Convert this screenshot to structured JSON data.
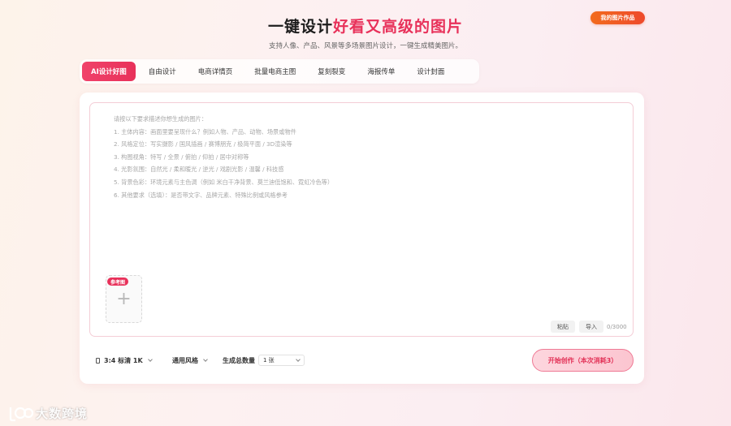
{
  "header": {
    "title_plain": "一键设计",
    "title_highlight": "好看又高级的图片",
    "subtitle": "支持人像、产品、风景等多场景图片设计，一键生成精美图片。",
    "my_works_label": "我的图片作品"
  },
  "tabs": [
    {
      "label": "AI设计好图",
      "active": true
    },
    {
      "label": "自由设计",
      "active": false
    },
    {
      "label": "电商详情页",
      "active": false
    },
    {
      "label": "批量电商主图",
      "active": false
    },
    {
      "label": "复刻裂变",
      "active": false
    },
    {
      "label": "海报传单",
      "active": false
    },
    {
      "label": "设计封面",
      "active": false
    }
  ],
  "editor": {
    "prompt_lines": [
      "请按以下要求描述你想生成的图片：",
      "1. 主体内容：画面里要呈现什么？例如人物、产品、动物、场景或物件",
      "2. 风格定位：写实摄影 / 国风插画 / 赛博朋克 / 极简平面 / 3D渲染等",
      "3. 构图视角：特写 / 全景 / 俯拍 / 仰拍 / 居中对称等",
      "4. 光影氛围：自然光 / 柔和暖光 / 逆光 / 戏剧光影 / 温馨 / 科技感",
      "5. 背景色彩：环境元素与主色调（例如 米白干净背景、莫兰迪低饱和、霓虹冷色等）",
      "6. 其他要求（选填）：是否带文字、品牌元素、特殊比例或风格参考"
    ],
    "ref_badge": "参考图",
    "plus_symbol": "+",
    "paste_label": "粘贴",
    "import_label": "导入",
    "char_count": "0/3000"
  },
  "controls": {
    "ratio_label": "3:4 标清 1K",
    "style_label": "通用风格",
    "quantity_label": "生成总数量",
    "quantity_value": "1 张",
    "start_label": "开始创作（本次消耗3）"
  },
  "watermark": {
    "text": "大数跨境"
  },
  "colors": {
    "accent": "#e8315a",
    "orange_button": "#f26b1d"
  }
}
